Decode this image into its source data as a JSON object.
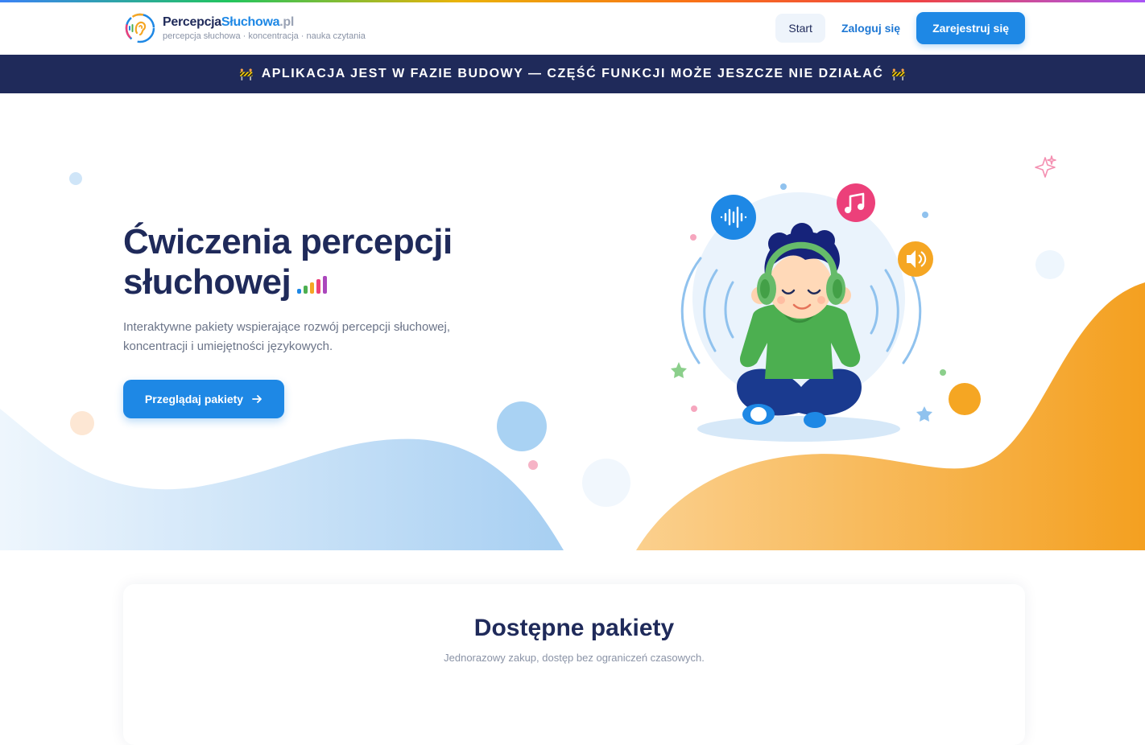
{
  "header": {
    "brand": {
      "part1": "Percepcja",
      "part2": "Słuchowa",
      "part3": ".pl"
    },
    "tagline": "percepcja słuchowa · koncentracja · nauka czytania",
    "nav": {
      "start": "Start",
      "login": "Zaloguj się",
      "register": "Zarejestruj się"
    }
  },
  "banner": {
    "icon_left": "🚧",
    "text": "APLIKACJA JEST W FAZIE BUDOWY — CZĘŚĆ FUNKCJI MOŻE JESZCZE NIE DZIAŁAĆ",
    "icon_right": "🚧"
  },
  "hero": {
    "title_line1": "Ćwiczenia percepcji",
    "title_line2": "słuchowej",
    "subtitle": "Interaktywne pakiety wspierające rozwój percepcji słuchowej, koncentracji i umiejętności językowych.",
    "cta_label": "Przeglądaj pakiety",
    "cta_icon": "arrow-right-icon"
  },
  "packages": {
    "title": "Dostępne pakiety",
    "subtitle": "Jednorazowy zakup, dostęp bez ograniczeń czasowych."
  },
  "colors": {
    "primary": "#1e88e5",
    "navy": "#1f2a5a",
    "orange": "#f5a623",
    "light_blue": "#a9d2f3",
    "pink": "#ec407a",
    "green": "#4caf50"
  }
}
